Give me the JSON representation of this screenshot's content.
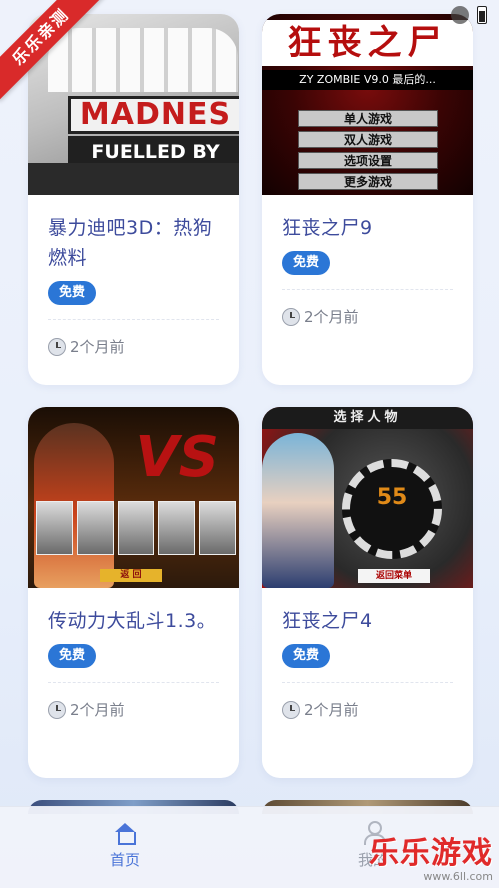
{
  "watermark": {
    "ribbon": "乐乐亲测"
  },
  "cards": [
    {
      "title": "暴力迪吧3D：热狗燃料",
      "badge": "免费",
      "time": "2个月前",
      "thumb": {
        "banner": "MADNES",
        "banner2": "FUELLED BY HOTDO"
      }
    },
    {
      "title": "狂丧之尸9",
      "badge": "免费",
      "time": "2个月前",
      "thumb": {
        "logo": "狂丧之尸",
        "sub": "ZY ZOMBIE V9.0  最后的...",
        "menu": [
          "单人游戏",
          "双人游戏",
          "选项设置",
          "更多游戏"
        ]
      }
    },
    {
      "title": "传动力大乱斗1.3。",
      "badge": "免费",
      "time": "2个月前",
      "thumb": {
        "vs": "VS",
        "button": "返 回"
      }
    },
    {
      "title": "狂丧之尸4",
      "badge": "免费",
      "time": "2个月前",
      "thumb": {
        "header": "选择人物",
        "number": "55",
        "button": "返回菜单"
      }
    }
  ],
  "nav": {
    "home": {
      "label": "首页",
      "icon": "home-icon"
    },
    "me": {
      "label": "我的",
      "icon": "user-icon"
    }
  },
  "brand": {
    "name": "乐乐游戏",
    "url": "www.6ll.com"
  },
  "colors": {
    "accent": "#2b76d6",
    "title": "#3d4b9c",
    "nav_active": "#4a74d8",
    "brand_red": "#e02a2a"
  }
}
